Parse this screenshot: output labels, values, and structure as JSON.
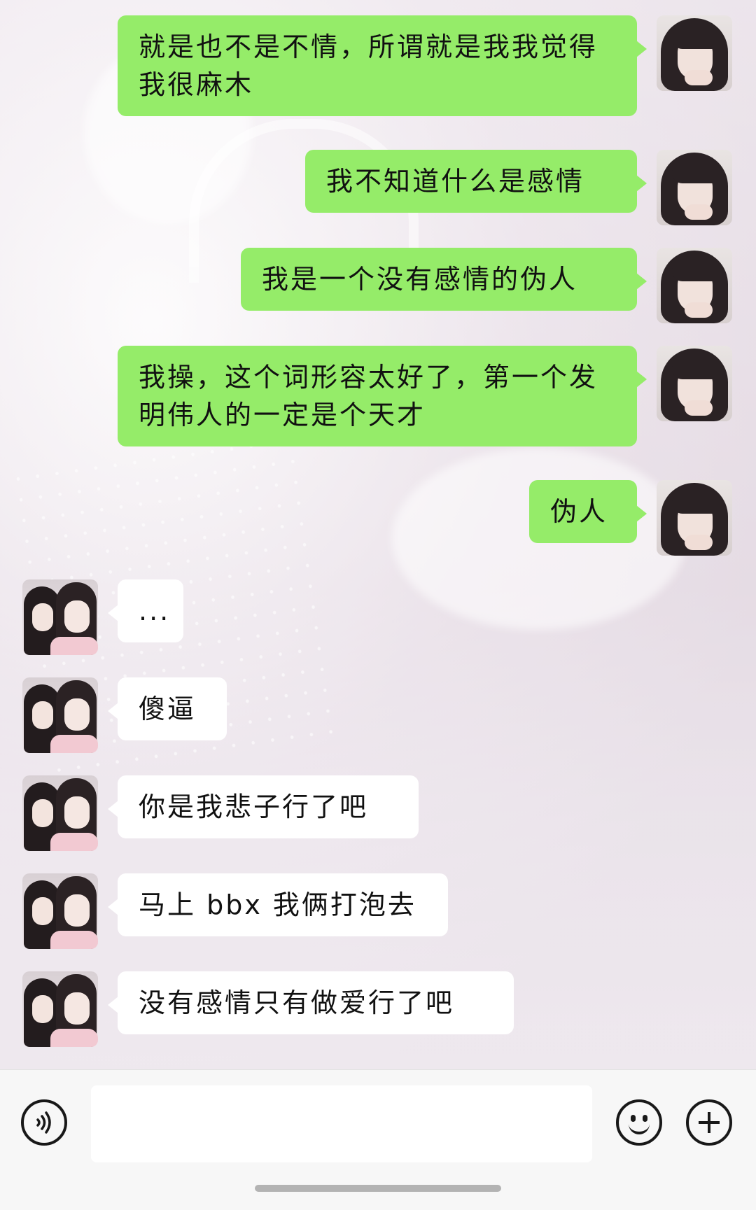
{
  "chat": {
    "messages": [
      {
        "sender": "self",
        "text": "就是也不是不情，所谓就是我我觉得我很麻木"
      },
      {
        "sender": "self",
        "text": "我不知道什么是感情"
      },
      {
        "sender": "self",
        "text": "我是一个没有感情的伪人"
      },
      {
        "sender": "self",
        "text": "我操，这个词形容太好了，第一个发明伟人的一定是个天才"
      },
      {
        "sender": "self",
        "text": "伪人"
      },
      {
        "sender": "other",
        "text": "..."
      },
      {
        "sender": "other",
        "text": "傻逼"
      },
      {
        "sender": "other",
        "text": "你是我悲子行了吧"
      },
      {
        "sender": "other",
        "text": "马上 bbx 我俩打泡去"
      },
      {
        "sender": "other",
        "text": "没有感情只有做爱行了吧"
      }
    ]
  },
  "colors": {
    "self_bubble": "#95ec69",
    "other_bubble": "#ffffff"
  },
  "input_bar": {
    "message_value": "",
    "icons": [
      "voice-icon",
      "emoji-icon",
      "plus-icon"
    ]
  }
}
